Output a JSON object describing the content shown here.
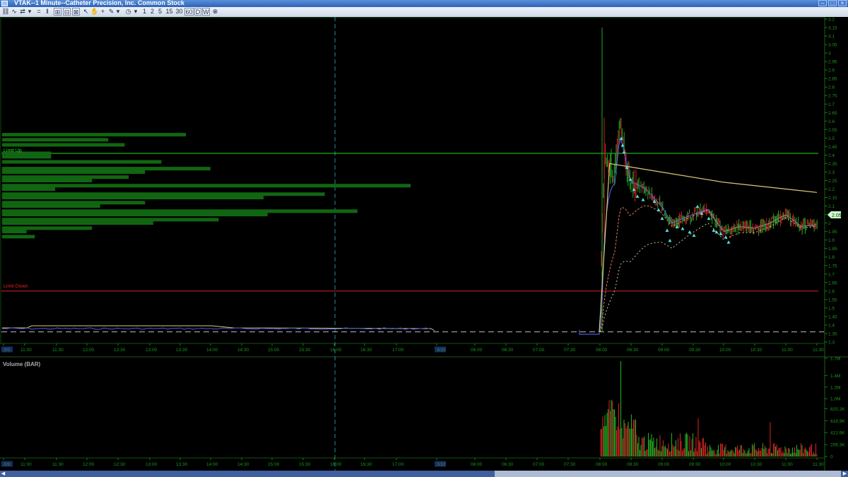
{
  "window": {
    "title": "VTAK--1 Minute--Catheter Precision, Inc. Common Stock"
  },
  "toolbar": {
    "period_buttons": [
      "1",
      "2",
      "5",
      "15",
      "30",
      "60",
      "D",
      "W"
    ]
  },
  "colors": {
    "background": "#000000",
    "price_axis": "#00aa00",
    "limit_up": "#22dd22",
    "limit_down": "#dd2222",
    "volume_profile": "#116611",
    "vwap": "#d8c878",
    "bar_up": "#22aa22",
    "bar_down": "#cc2222",
    "marker": "#55dddd"
  },
  "labels": {
    "limit_up": "Limit Up",
    "limit_down": "Limit Down",
    "volume_title": "Volume (BAR)",
    "last_price": "2.05"
  },
  "chart_data": [
    {
      "type": "line",
      "title": "VTAK--1 Minute--Catheter Precision, Inc. Common Stock",
      "ylim": [
        1.3,
        3.2
      ],
      "y_ticks": [
        "3.2",
        "3.15",
        "3.1",
        "3.05",
        "3",
        "2.95",
        "2.9",
        "2.85",
        "2.8",
        "2.75",
        "2.7",
        "2.65",
        "2.6",
        "2.55",
        "2.5",
        "2.45",
        "2.4",
        "2.35",
        "2.3",
        "2.25",
        "2.2",
        "2.15",
        "2.1",
        "2.05",
        "2",
        "1.95",
        "1.9",
        "1.85",
        "1.8",
        "1.75",
        "1.7",
        "1.65",
        "1.6",
        "1.55",
        "1.5",
        "1.45",
        "1.4",
        "1.35",
        "1.3"
      ],
      "x_ticks": [
        "3/9",
        "11:00",
        "11:30",
        "12:00",
        "12:30",
        "13:00",
        "13:30",
        "14:00",
        "14:30",
        "15:00",
        "15:30",
        "16:00",
        "16:30",
        "17:00",
        "3/10",
        "06:00",
        "06:30",
        "07:00",
        "07:30",
        "08:00",
        "08:30",
        "09:00",
        "09:30",
        "10:00",
        "10:30",
        "11:00",
        "11:30"
      ],
      "limit_up": 2.41,
      "limit_down": 1.6,
      "reference_price": 1.36,
      "last_price": 2.05,
      "price_series": {
        "x": [
          "3/9 10:40",
          "3/9 16:00",
          "3/9 18:00",
          "3/10 07:45",
          "3/10 08:00",
          "3/10 08:05",
          "3/10 08:15",
          "3/10 08:20",
          "3/10 08:30",
          "3/10 08:45",
          "3/10 09:00",
          "3/10 09:10",
          "3/10 09:30",
          "3/10 09:45",
          "3/10 10:00",
          "3/10 10:15",
          "3/10 10:30",
          "3/10 10:45",
          "3/10 11:00",
          "3/10 11:15",
          "3/10 11:30"
        ],
        "y": [
          1.37,
          1.37,
          1.36,
          1.35,
          1.36,
          2.4,
          2.3,
          2.55,
          2.25,
          2.2,
          2.1,
          2.0,
          2.05,
          2.08,
          1.95,
          1.98,
          1.97,
          2.0,
          2.05,
          1.98,
          1.99
        ]
      },
      "vwap_series": {
        "x": [
          "3/9 10:40",
          "3/9 18:00",
          "3/10 08:00",
          "3/10 08:10",
          "3/10 08:30",
          "3/10 09:00",
          "3/10 10:00",
          "3/10 11:00",
          "3/10 11:30"
        ],
        "y": [
          1.38,
          1.38,
          1.36,
          2.35,
          2.33,
          2.3,
          2.24,
          2.2,
          2.18
        ]
      },
      "volume_profile": [
        {
          "price": 2.52,
          "size": 0.45
        },
        {
          "price": 2.49,
          "size": 0.26
        },
        {
          "price": 2.46,
          "size": 0.3
        },
        {
          "price": 2.41,
          "size": 0.12
        },
        {
          "price": 2.39,
          "size": 0.12
        },
        {
          "price": 2.36,
          "size": 0.39
        },
        {
          "price": 2.32,
          "size": 0.51
        },
        {
          "price": 2.3,
          "size": 0.35
        },
        {
          "price": 2.27,
          "size": 0.31
        },
        {
          "price": 2.25,
          "size": 0.22
        },
        {
          "price": 2.22,
          "size": 1.0
        },
        {
          "price": 2.2,
          "size": 0.13
        },
        {
          "price": 2.17,
          "size": 0.79
        },
        {
          "price": 2.15,
          "size": 0.64
        },
        {
          "price": 2.12,
          "size": 0.35
        },
        {
          "price": 2.1,
          "size": 0.24
        },
        {
          "price": 2.07,
          "size": 0.87
        },
        {
          "price": 2.05,
          "size": 0.65
        },
        {
          "price": 2.02,
          "size": 0.53
        },
        {
          "price": 2.0,
          "size": 0.37
        },
        {
          "price": 1.97,
          "size": 0.22
        },
        {
          "price": 1.95,
          "size": 0.06
        },
        {
          "price": 1.92,
          "size": 0.08
        }
      ]
    },
    {
      "type": "bar",
      "title": "Volume (BAR)",
      "ylim": [
        0,
        1650000
      ],
      "y_ticks": [
        "1.7M",
        "1.4M",
        "1.2M",
        "1.0M",
        "825.2K",
        "618.9K",
        "412.6K",
        "206.3K",
        "0"
      ],
      "x_ticks": [
        "3/9",
        "11:00",
        "11:30",
        "12:00",
        "12:30",
        "13:00",
        "13:30",
        "14:00",
        "14:30",
        "15:00",
        "15:30",
        "16:00",
        "16:30",
        "17:00",
        "3/10",
        "06:00",
        "06:30",
        "07:00",
        "07:30",
        "08:00",
        "08:30",
        "09:00",
        "09:30",
        "10:00",
        "10:30",
        "11:00",
        "11:30"
      ],
      "peak_volume": 1650000,
      "session_start": "3/10 08:00",
      "session_end": "3/10 11:35"
    }
  ]
}
